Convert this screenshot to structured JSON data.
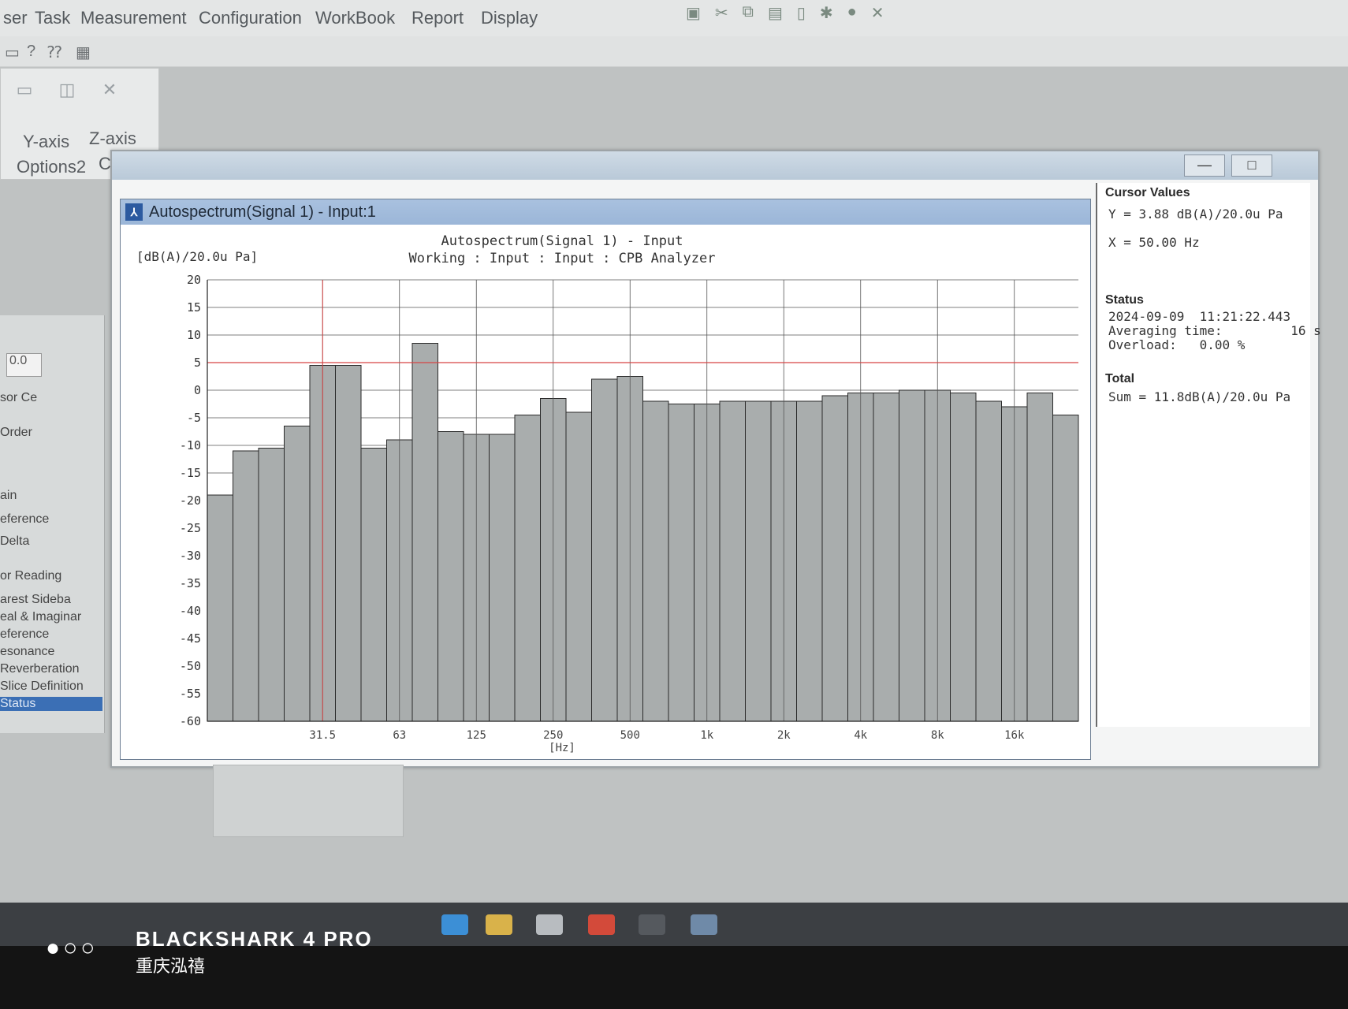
{
  "menu": {
    "items": [
      "ser",
      "Task",
      "Measurement",
      "Configuration",
      "WorkBook",
      "Report",
      "Display"
    ]
  },
  "toolbar2": {
    "icons": [
      "page-icon",
      "help-icon",
      "context-help-icon",
      "grid-icon"
    ]
  },
  "left_panel": {
    "tabs": [
      "Y-axis",
      "Z-axis",
      "Options2",
      "Color"
    ],
    "value_field": "0.0",
    "list": [
      "sor Ce",
      "Order",
      "ain",
      "eference",
      "Delta",
      "or Reading",
      "arest Sideba",
      "eal & Imaginar",
      "eference",
      "esonance",
      "Reverberation",
      "Slice Definition",
      "Status"
    ],
    "selected": "Status"
  },
  "window": {
    "title": "Autospectrum(Signal 1) - Input:1",
    "minimize_label": "—",
    "maximize_label": "□"
  },
  "chart_data": {
    "type": "bar",
    "title": "Autospectrum(Signal 1) - Input",
    "subtitle": "Working : Input : Input : CPB Analyzer",
    "ylabel": "[dB(A)/20.0u Pa]",
    "xlabel": "[Hz]",
    "ylim": [
      -60,
      20
    ],
    "yticks": [
      20,
      15,
      10,
      5,
      0,
      -5,
      -10,
      -15,
      -20,
      -25,
      -30,
      -35,
      -40,
      -45,
      -50,
      -55,
      -60
    ],
    "xtick_labels": [
      "31.5",
      "63",
      "125",
      "250",
      "500",
      "1k",
      "2k",
      "4k",
      "8k",
      "16k"
    ],
    "values": [
      -19,
      -11,
      -10.5,
      -6.5,
      4.5,
      4.5,
      -10.5,
      -9,
      8.5,
      -7.5,
      -8,
      -8,
      -4.5,
      -1.5,
      -4,
      2,
      2.5,
      -2,
      -2.5,
      -2.5,
      -2,
      -2,
      -2,
      -2,
      -1,
      -0.5,
      -0.5,
      0,
      0,
      -0.5,
      -2,
      -3,
      -0.5,
      -4.5
    ],
    "cursor_x_band": 4,
    "reference_line": 5,
    "grid": true
  },
  "info": {
    "cursor_title": "Cursor Values",
    "cursor_y": "Y = 3.88 dB(A)/20.0u Pa",
    "cursor_x": "X = 50.00 Hz",
    "status_title": "Status",
    "status_date": "2024-09-09  11:21:22.443",
    "status_avg": "Averaging time:         16 s",
    "status_overload": "Overload:   0.00 %",
    "total_title": "Total",
    "total_sum": "Sum = 11.8dB(A)/20.0u Pa"
  },
  "watermark": {
    "dots": "●○○",
    "brand": "BLACKSHARK 4 PRO",
    "sub": "重庆泓禧"
  },
  "colors": {
    "bar": "#a9adad",
    "bar_stroke": "#2a2a2a",
    "grid": "#555555",
    "reference": "#d64545",
    "title_bar": "#9bb6d8",
    "selected": "#3b6fb5"
  }
}
